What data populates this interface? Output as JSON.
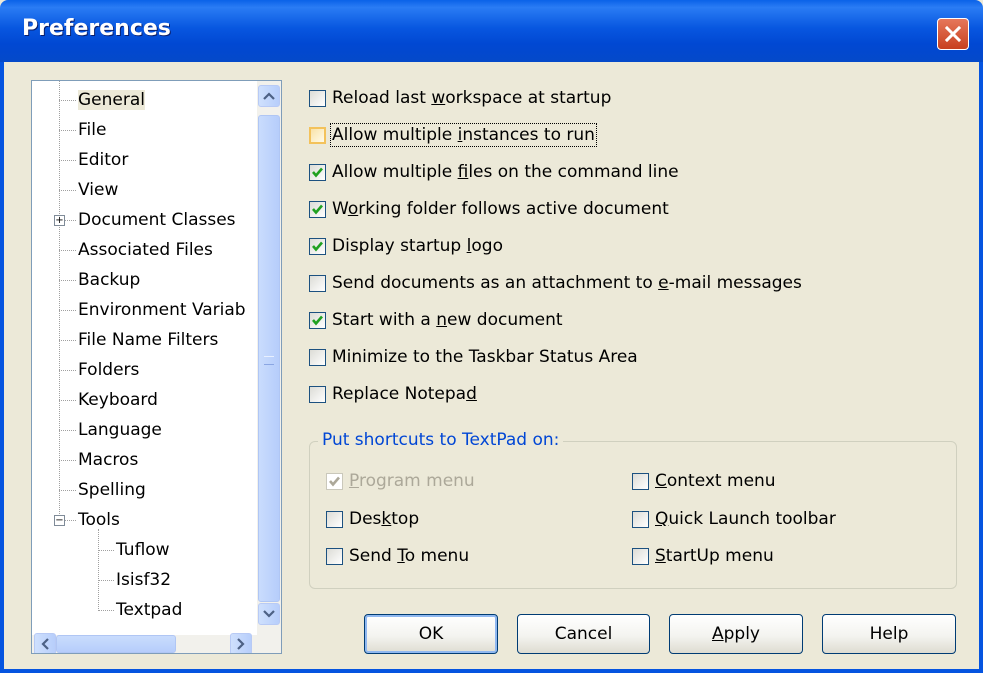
{
  "window": {
    "title": "Preferences"
  },
  "tree": {
    "items": [
      {
        "label": "General",
        "selected": true
      },
      {
        "label": "File"
      },
      {
        "label": "Editor"
      },
      {
        "label": "View"
      },
      {
        "label": "Document Classes",
        "expander": "+"
      },
      {
        "label": "Associated Files"
      },
      {
        "label": "Backup"
      },
      {
        "label": "Environment Variab"
      },
      {
        "label": "File Name Filters"
      },
      {
        "label": "Folders"
      },
      {
        "label": "Keyboard"
      },
      {
        "label": "Language"
      },
      {
        "label": "Macros"
      },
      {
        "label": "Spelling"
      },
      {
        "label": "Tools",
        "expander": "−"
      },
      {
        "label": "Tuflow",
        "child": true
      },
      {
        "label": "Isisf32",
        "child": true
      },
      {
        "label": "Textpad",
        "child": true
      }
    ]
  },
  "options": [
    {
      "pre": "Reload last ",
      "ul": "w",
      "post": "orkspace at startup",
      "checked": false
    },
    {
      "pre": "Allow multiple ",
      "ul": "i",
      "post": "nstances to run",
      "checked": false,
      "focused": true
    },
    {
      "pre": "Allow multiple ",
      "ul": "f",
      "post": "iles on the command line",
      "checked": true
    },
    {
      "pre": "W",
      "ul": "o",
      "post": "rking folder follows active document",
      "checked": true
    },
    {
      "pre": "Display startup ",
      "ul": "l",
      "post": "ogo",
      "checked": true
    },
    {
      "pre": "Send documents as an attachment to ",
      "ul": "e",
      "post": "-mail messages",
      "checked": false
    },
    {
      "pre": "Start with a ",
      "ul": "n",
      "post": "ew document",
      "checked": true
    },
    {
      "pre": "Minimize to the Taskbar Status Area",
      "ul": "",
      "post": "",
      "checked": false
    },
    {
      "pre": "Replace Notepa",
      "ul": "d",
      "post": "",
      "checked": false
    }
  ],
  "shortcuts": {
    "title": "Put shortcuts to TextPad on:",
    "items": [
      {
        "pre": "",
        "ul": "P",
        "post": "rogram menu",
        "checked": true,
        "disabled": true
      },
      {
        "pre": "",
        "ul": "C",
        "post": "ontext menu",
        "checked": false
      },
      {
        "pre": "Des",
        "ul": "k",
        "post": "top",
        "checked": false
      },
      {
        "pre": "",
        "ul": "Q",
        "post": "uick Launch toolbar",
        "checked": false
      },
      {
        "pre": "Send ",
        "ul": "T",
        "post": "o menu",
        "checked": false
      },
      {
        "pre": "",
        "ul": "S",
        "post": "tartUp menu",
        "checked": false
      }
    ]
  },
  "buttons": {
    "ok": "OK",
    "cancel": "Cancel",
    "apply_ul": "A",
    "apply_rest": "pply",
    "help": "Help"
  },
  "colors": {
    "titlebar": "#0554e0",
    "dialog_bg": "#ece9d8",
    "group_title": "#0046d5",
    "check": "#21a121"
  }
}
